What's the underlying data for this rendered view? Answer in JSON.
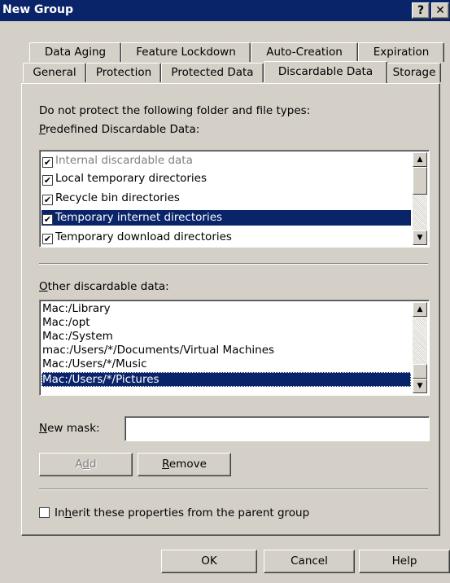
{
  "window": {
    "title": "New Group",
    "help_label": "?",
    "close_label": "✕"
  },
  "tabs": {
    "row1": [
      "Data Aging",
      "Feature Lockdown",
      "Auto-Creation",
      "Expiration"
    ],
    "row2": [
      "General",
      "Protection",
      "Protected Data",
      "Discardable Data",
      "Storage"
    ],
    "active": "Discardable Data"
  },
  "panel": {
    "intro_text": "Do not protect the following folder and file types:",
    "predefined_label_key": "P",
    "predefined_label_rest": "redefined Discardable Data:",
    "predefined_items": [
      {
        "label": "Internal discardable data",
        "checked": true,
        "disabled": true
      },
      {
        "label": "Local temporary directories",
        "checked": true
      },
      {
        "label": "Recycle bin directories",
        "checked": true
      },
      {
        "label": "Temporary internet directories",
        "checked": true,
        "selected": true
      },
      {
        "label": "Temporary download directories",
        "checked": true
      }
    ],
    "other_label_key": "O",
    "other_label_rest": "ther discardable data:",
    "other_items": [
      {
        "label": "Mac:/Library"
      },
      {
        "label": "Mac:/opt"
      },
      {
        "label": "Mac:/System"
      },
      {
        "label": "mac:/Users/*/Documents/Virtual Machines"
      },
      {
        "label": "Mac:/Users/*/Music"
      },
      {
        "label": "Mac:/Users/*/Pictures",
        "selected": true
      }
    ],
    "new_mask_key": "N",
    "new_mask_rest": "ew mask:",
    "new_mask_value": "",
    "add_button_pre": "A",
    "add_button_key": "d",
    "add_button_post": "d",
    "remove_button_key": "R",
    "remove_button_rest": "emove",
    "inherit_checked": false,
    "inherit_pre": "In",
    "inherit_key": "h",
    "inherit_post": "erit these properties from the parent group"
  },
  "footer": {
    "ok_label": "OK",
    "cancel_label": "Cancel",
    "help_label": "Help"
  },
  "colors": {
    "titlebar": "#0a246a",
    "selection": "#0a246a",
    "face": "#d4d0c8"
  }
}
